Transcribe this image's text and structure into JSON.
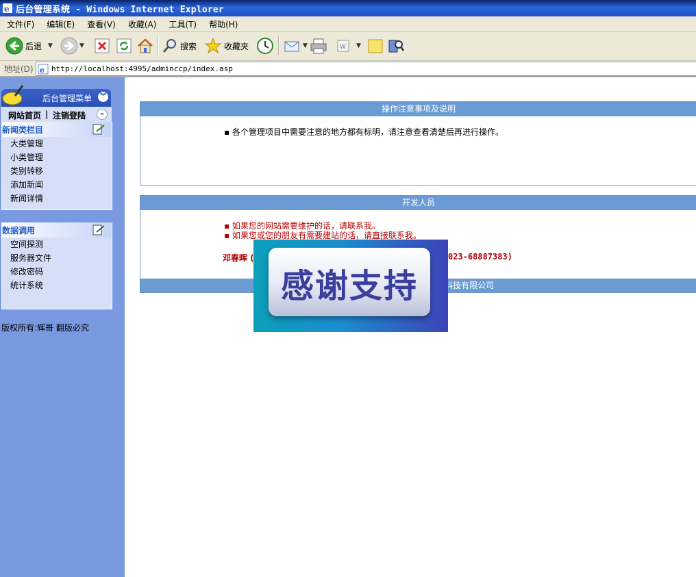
{
  "window": {
    "title": "后台管理系统 - Windows Internet Explorer"
  },
  "menubar": {
    "items": [
      "文件(F)",
      "编辑(E)",
      "查看(V)",
      "收藏(A)",
      "工具(T)",
      "帮助(H)"
    ]
  },
  "toolbar": {
    "back_label": "后退",
    "search_label": "搜索",
    "favorites_label": "收藏夹"
  },
  "addressbar": {
    "label": "地址(D)",
    "url": "http://localhost:4995/adminccp/index.asp"
  },
  "sidebar": {
    "header_title": "后台管理菜单",
    "links": {
      "home": "网站首页",
      "sep": "|",
      "logout": "注销登陆"
    },
    "sections": [
      {
        "title": "新闻类栏目",
        "items": [
          "大类管理",
          "小类管理",
          "类别转移",
          "添加新闻",
          "新闻详情"
        ]
      },
      {
        "title": "数据调用",
        "items": [
          "空间探测",
          "服务器文件",
          "修改密码",
          "统计系统"
        ]
      }
    ],
    "copyright": "版权所有:辉哥 翻版必究"
  },
  "main": {
    "notice": {
      "title": "操作注意事项及说明",
      "text": "各个管理项目中需要注意的地方都有标明，请注意查看清楚后再进行操作。"
    },
    "developers": {
      "title": "开发人员",
      "lines": [
        "如果您的网站需要维护的话，请联系我。",
        "如果您或您的朋友有需要建站的话，请直接联系我。"
      ],
      "contact_name": "邓春晖 (",
      "contact_phone": "023-68887383)",
      "footer": "欢迎来到企业建站-中国CCP科技有限公司"
    }
  },
  "popup": {
    "text": "感谢支持"
  },
  "colors": {
    "panel_head": "#6b9bd4",
    "sidebar_bg": "#799ae1",
    "red_text": "#b30000"
  }
}
